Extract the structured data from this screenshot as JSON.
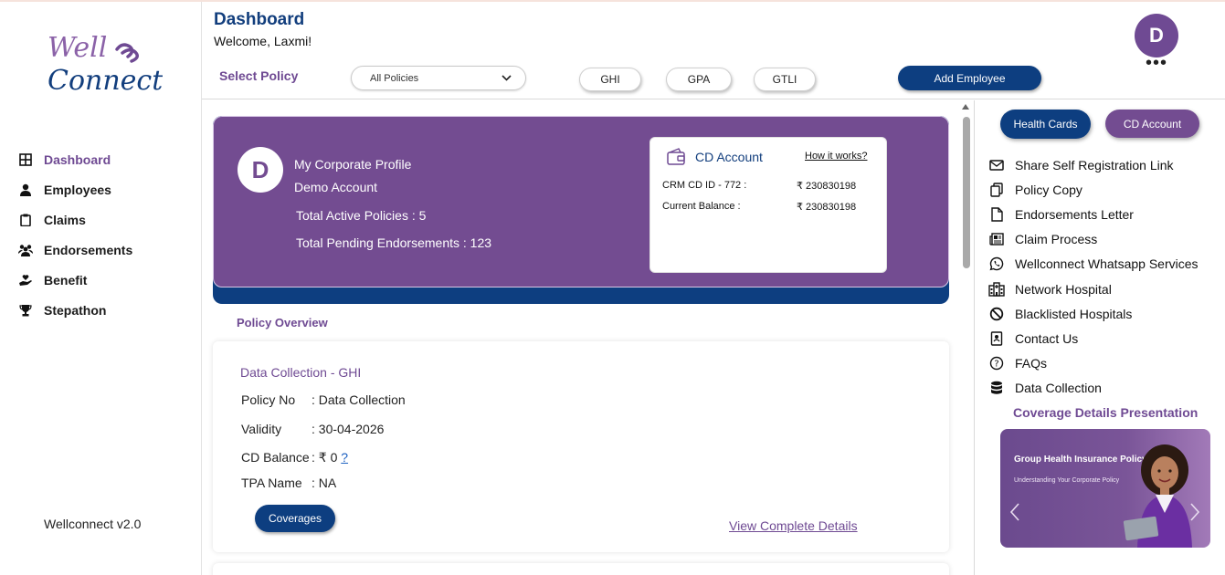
{
  "header": {
    "title": "Dashboard",
    "welcome": "Welcome, Laxmi!",
    "select_policy_label": "Select Policy",
    "policy_select_value": "All Policies",
    "pills": [
      "GHI",
      "GPA",
      "GTLI"
    ],
    "add_employee": "Add Employee",
    "avatar_initial": "D",
    "more": "•••"
  },
  "brand": {
    "line1": "Well",
    "line2": "Connect"
  },
  "sidebar": {
    "items": [
      {
        "label": "Dashboard",
        "icon": "grid-icon",
        "active": true
      },
      {
        "label": "Employees",
        "icon": "person-icon"
      },
      {
        "label": "Claims",
        "icon": "clipboard-icon"
      },
      {
        "label": "Endorsements",
        "icon": "group-icon"
      },
      {
        "label": "Benefit",
        "icon": "hand-heart-icon"
      },
      {
        "label": "Stepathon",
        "icon": "trophy-icon"
      }
    ],
    "version": "Wellconnect v2.0"
  },
  "profile": {
    "initial": "D",
    "title": "My Corporate Profile",
    "account": "Demo Account",
    "active_policies": "Total Active Policies : 5",
    "pending_endorsements": "Total Pending Endorsements : 123"
  },
  "cd_account": {
    "title": "CD Account",
    "how": "How it works?",
    "row1_label": "CRM CD ID - 772 :",
    "row1_value": "₹ 230830198",
    "row2_label": "Current Balance :",
    "row2_value": "₹ 230830198"
  },
  "overview": {
    "title": "Policy Overview",
    "card_title": "Data Collection - GHI",
    "policy_no_label": "Policy No",
    "policy_no_value": ": Data Collection",
    "validity_label": "Validity",
    "validity_value": ": 30-04-2026",
    "cd_balance_label": "CD Balance",
    "cd_balance_value": ": ₹ 0",
    "cd_balance_help": "?",
    "tpa_label": "TPA Name",
    "tpa_value": ": NA",
    "coverages_button": "Coverages",
    "view_details": "View Complete Details"
  },
  "right_panel": {
    "health_cards": "Health Cards",
    "cd_account": "CD Account",
    "links": [
      {
        "label": "Share Self Registration Link",
        "icon": "mail-icon"
      },
      {
        "label": "Policy Copy",
        "icon": "copy-icon"
      },
      {
        "label": "Endorsements Letter",
        "icon": "document-icon"
      },
      {
        "label": "Claim Process",
        "icon": "newspaper-icon"
      },
      {
        "label": "Wellconnect Whatsapp Services",
        "icon": "whatsapp-icon"
      },
      {
        "label": "Network Hospital",
        "icon": "hospital-icon"
      },
      {
        "label": "Blacklisted Hospitals",
        "icon": "ban-icon"
      },
      {
        "label": "Contact Us",
        "icon": "contact-icon"
      },
      {
        "label": "FAQs",
        "icon": "question-icon"
      },
      {
        "label": "Data Collection",
        "icon": "database-icon"
      }
    ],
    "coverage_title": "Coverage Details Presentation",
    "banner_title": "Group Health Insurance Policy",
    "banner_subtitle": "Understanding Your Corporate Policy"
  },
  "colors": {
    "brand_purple": "#734c91",
    "brand_navy": "#0d3e80"
  }
}
